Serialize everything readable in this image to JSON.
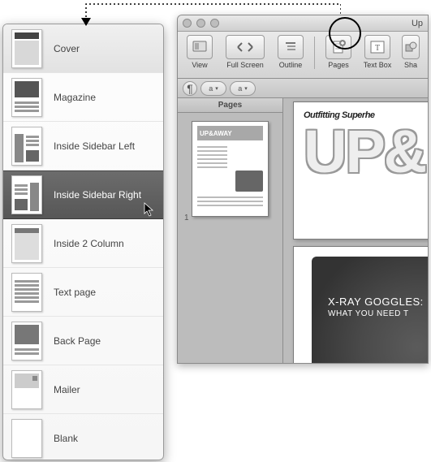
{
  "templateMenu": {
    "items": [
      {
        "label": "Cover",
        "selected": false
      },
      {
        "label": "Magazine",
        "selected": false
      },
      {
        "label": "Inside Sidebar Left",
        "selected": false
      },
      {
        "label": "Inside Sidebar Right",
        "selected": true
      },
      {
        "label": "Inside 2 Column",
        "selected": false
      },
      {
        "label": "Text page",
        "selected": false
      },
      {
        "label": "Back Page",
        "selected": false
      },
      {
        "label": "Mailer",
        "selected": false
      },
      {
        "label": "Blank",
        "selected": false
      }
    ]
  },
  "window": {
    "title": "Up"
  },
  "toolbar": {
    "view": {
      "label": "View"
    },
    "fullscreen": {
      "label": "Full Screen"
    },
    "outline": {
      "label": "Outline"
    },
    "pages": {
      "label": "Pages"
    },
    "textbox": {
      "label": "Text Box"
    },
    "shapes": {
      "label": "Sha"
    }
  },
  "formatbar": {
    "font_sample": "a"
  },
  "pagesPanel": {
    "header": "Pages",
    "pages": [
      {
        "number": "1",
        "masthead": "UP&AWAY"
      }
    ]
  },
  "document": {
    "kicker": "Outfitting Superhe",
    "masthead_fragment": "UP&",
    "ad": {
      "line1": "X-RAY GOGGLES:",
      "line2": "WHAT YOU NEED T"
    }
  }
}
